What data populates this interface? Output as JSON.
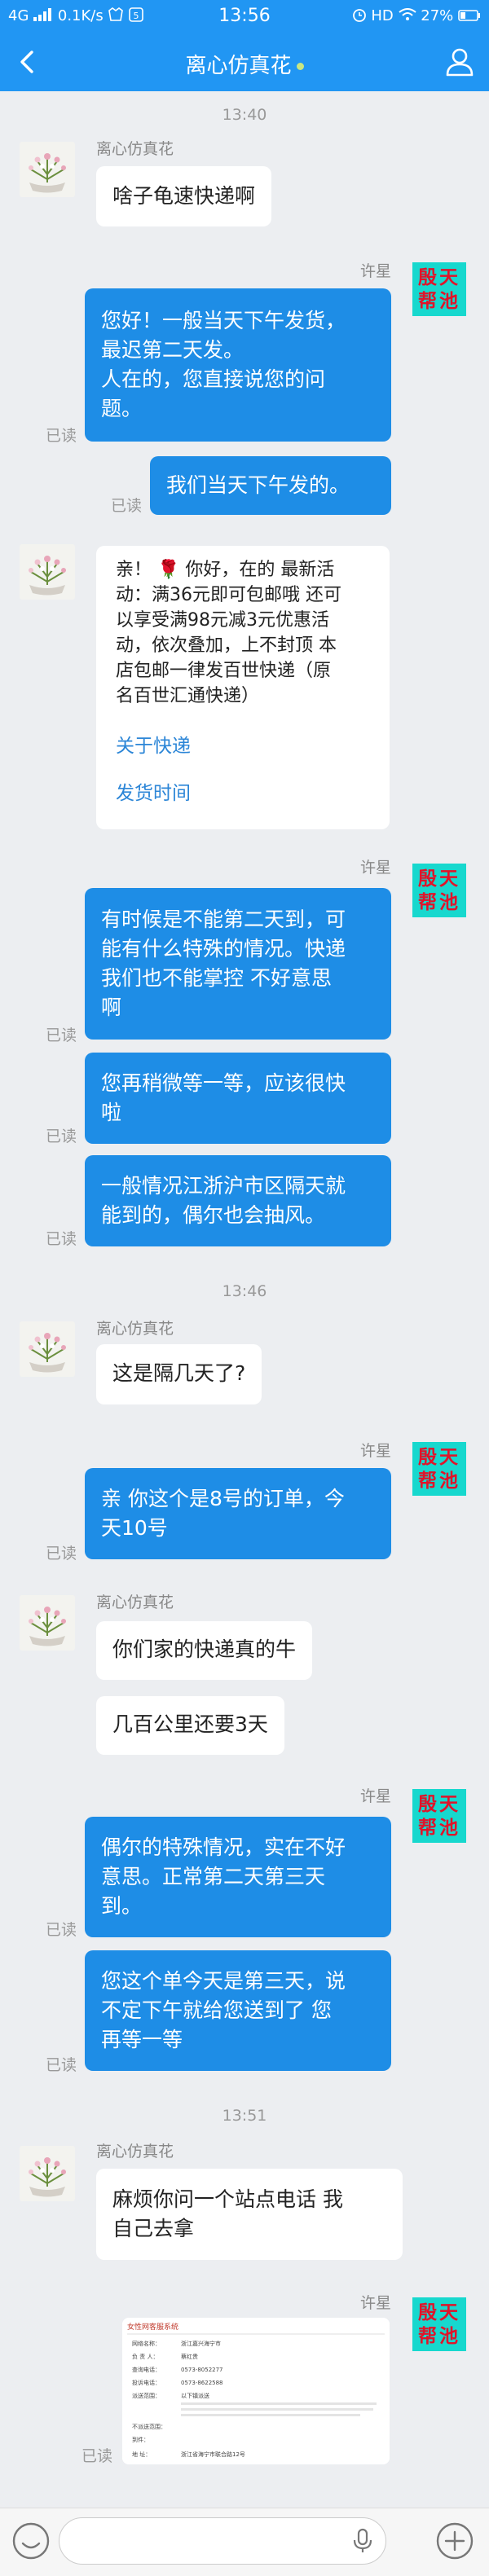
{
  "status_bar": {
    "network": "4G",
    "speed": "0.1K/s",
    "time": "13:56",
    "hd": "HD",
    "battery": "27%"
  },
  "header": {
    "title": "离心仿真花"
  },
  "service": {
    "name": "许星",
    "avatar_text": [
      "殷天",
      "帮池"
    ]
  },
  "customer": {
    "name": "离心仿真花"
  },
  "read_label": "已读",
  "timestamps": [
    "13:40",
    "13:46",
    "13:51"
  ],
  "messages": {
    "m1": "啥子龟速快递啊",
    "m2": [
      "您好！一般当天下午发货，",
      "最迟第二天发。",
      "人在的，您直接说您的问",
      "题。"
    ],
    "m3": "我们当天下午发的。",
    "m4": {
      "text": [
        "亲！ 🌹 你好，在的 最新活",
        "动：满36元即可包邮哦 还可",
        "以享受满98元减3元优惠活",
        "动，依次叠加，上不封顶 本",
        "店包邮一律发百世快递（原",
        "名百世汇通快递）"
      ],
      "link1": "关于快递",
      "link2": "发货时间"
    },
    "m5": [
      "有时候是不能第二天到，可",
      "能有什么特殊的情况。快递",
      "我们也不能掌控 不好意思",
      "啊"
    ],
    "m6": [
      "您再稍微等一等，应该很快",
      "啦"
    ],
    "m7": [
      "一般情况江浙沪市区隔天就",
      "能到的，偶尔也会抽风。"
    ],
    "m8": "这是隔几天了?",
    "m9": [
      "亲 你这个是8号的订单，今",
      "天10号"
    ],
    "m10": "你们家的快递真的牛",
    "m11": "几百公里还要3天",
    "m12": [
      "偶尔的特殊情况，实在不好",
      "意思。正常第二天第三天",
      "到。"
    ],
    "m13": [
      "您这个单今天是第三天，说",
      "不定下午就给您送到了 您",
      "再等一等"
    ],
    "m14": [
      "麻烦你问一个站点电话 我",
      "自己去拿"
    ]
  },
  "screenshot": {
    "title": "女性网客服系统",
    "rows": [
      {
        "label": "网络名称：",
        "value": "浙江嘉兴海宁市"
      },
      {
        "label": "负 责 人：",
        "value": "蔡红贵"
      },
      {
        "label": "查询电话：",
        "value": "0573-8052277"
      },
      {
        "label": "投诉电话：",
        "value": "0573-8622588"
      },
      {
        "label": "派送范围：",
        "value": "以下镇派送"
      },
      {
        "label": "不派送范围：",
        "value": ""
      },
      {
        "label": "到件：",
        "value": ""
      },
      {
        "label": "地 址：",
        "value": "浙江省海宁市联合路12号"
      }
    ]
  },
  "input": {
    "placeholder": ""
  }
}
